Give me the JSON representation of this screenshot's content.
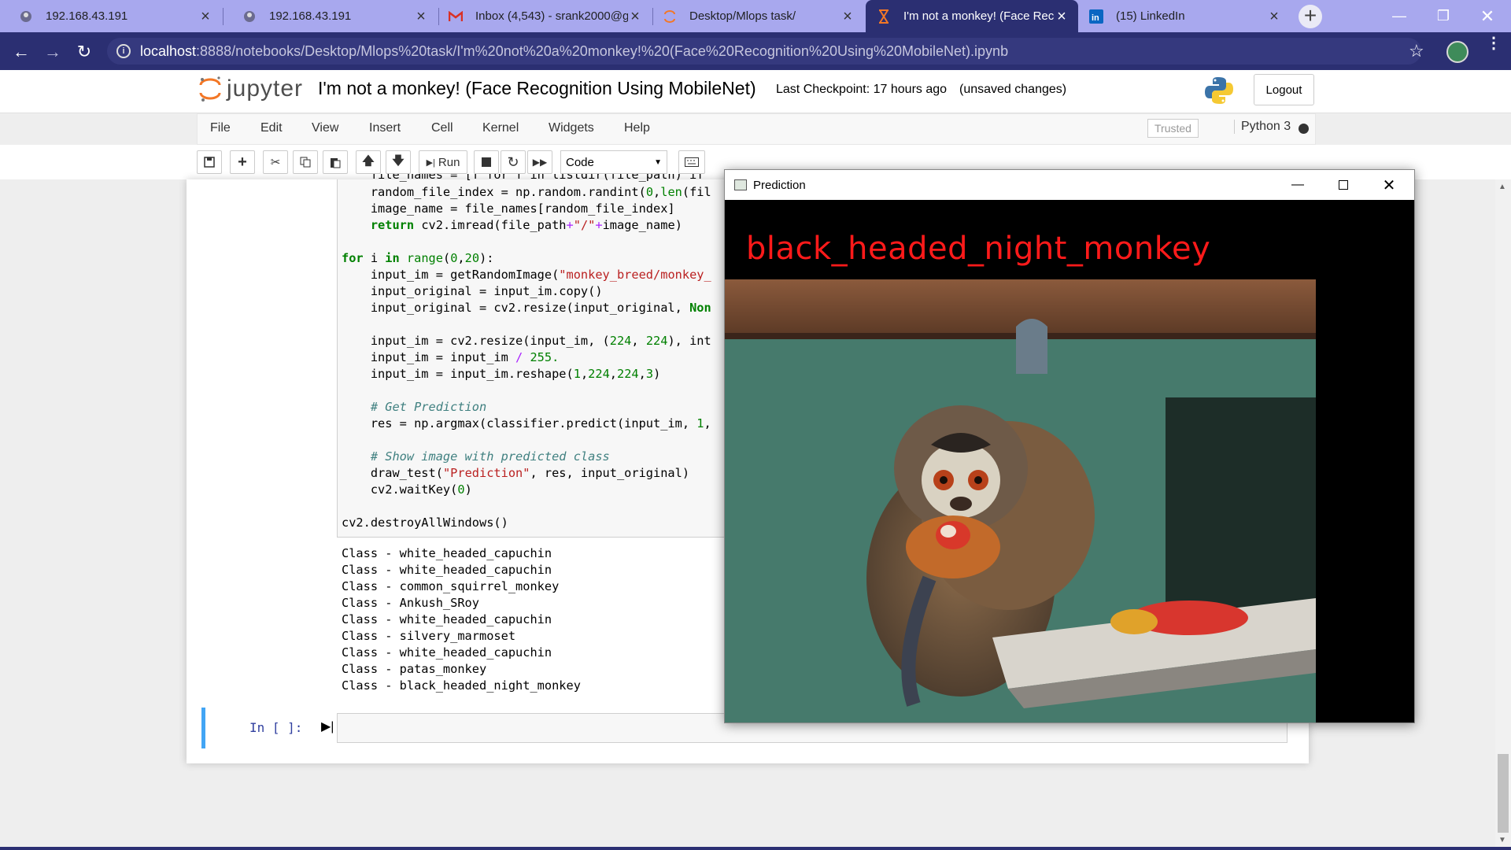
{
  "browser": {
    "tabs": [
      {
        "label": "192.168.43.191",
        "icon": "globe-icon"
      },
      {
        "label": "192.168.43.191",
        "icon": "globe-icon"
      },
      {
        "label": "Inbox (4,543) - srank2000@g",
        "icon": "gmail-icon"
      },
      {
        "label": "Desktop/Mlops task/",
        "icon": "jupyter-icon"
      },
      {
        "label": "I'm not a monkey! (Face Reco",
        "icon": "hourglass-icon",
        "active": true
      },
      {
        "label": "(15) LinkedIn",
        "icon": "linkedin-icon"
      }
    ],
    "url_host": "localhost",
    "url_path": ":8888/notebooks/Desktop/Mlops%20task/I'm%20not%20a%20monkey!%20(Face%20Recognition%20Using%20MobileNet).ipynb"
  },
  "jupyter": {
    "logo_text": "jupyter",
    "notebook_title": "I'm not a monkey! (Face Recognition Using MobileNet)",
    "checkpoint": "Last Checkpoint: 17 hours ago",
    "unsaved": "(unsaved changes)",
    "logout": "Logout",
    "menus": [
      "File",
      "Edit",
      "View",
      "Insert",
      "Cell",
      "Kernel",
      "Widgets",
      "Help"
    ],
    "trusted": "Trusted",
    "kernel": "Python 3",
    "run_label": "Run",
    "cell_type": "Code",
    "empty_prompt": "In [ ]:"
  },
  "code": {
    "line_cut": "    file_names = [f for f in listdir(file_path) if",
    "line1": "    random_file_index = np.random.randint(0,len(fil",
    "line2": "    image_name = file_names[random_file_index]",
    "line3": "    return cv2.imread(file_path+\"/\"+image_name)",
    "line4": "for i in range(0,20):",
    "line5": "    input_im = getRandomImage(\"monkey_breed/monkey_",
    "line6": "    input_original = input_im.copy()",
    "line7": "    input_original = cv2.resize(input_original, Non",
    "line8": "    input_im = cv2.resize(input_im, (224, 224), int",
    "line9": "    input_im = input_im / 255.",
    "line10": "    input_im = input_im.reshape(1,224,224,3)",
    "line11": "    # Get Prediction",
    "line12": "    res = np.argmax(classifier.predict(input_im, 1,",
    "line13": "    # Show image with predicted class",
    "line14": "    draw_test(\"Prediction\", res, input_original)",
    "line15": "    cv2.waitKey(0)",
    "line16": "cv2.destroyAllWindows()"
  },
  "output_lines": [
    "Class - white_headed_capuchin",
    "Class - white_headed_capuchin",
    "Class - common_squirrel_monkey",
    "Class - Ankush_SRoy",
    "Class - white_headed_capuchin",
    "Class - silvery_marmoset",
    "Class - white_headed_capuchin",
    "Class - patas_monkey",
    "Class - black_headed_night_monkey"
  ],
  "prediction_window": {
    "title": "Prediction",
    "label": "black_headed_night_monkey"
  },
  "colors": {
    "chrome_dark": "#2b2f72",
    "tabstrip": "#a8a8ee",
    "prediction_text": "#ff1a1a",
    "cell_selected": "#42a5f5"
  }
}
